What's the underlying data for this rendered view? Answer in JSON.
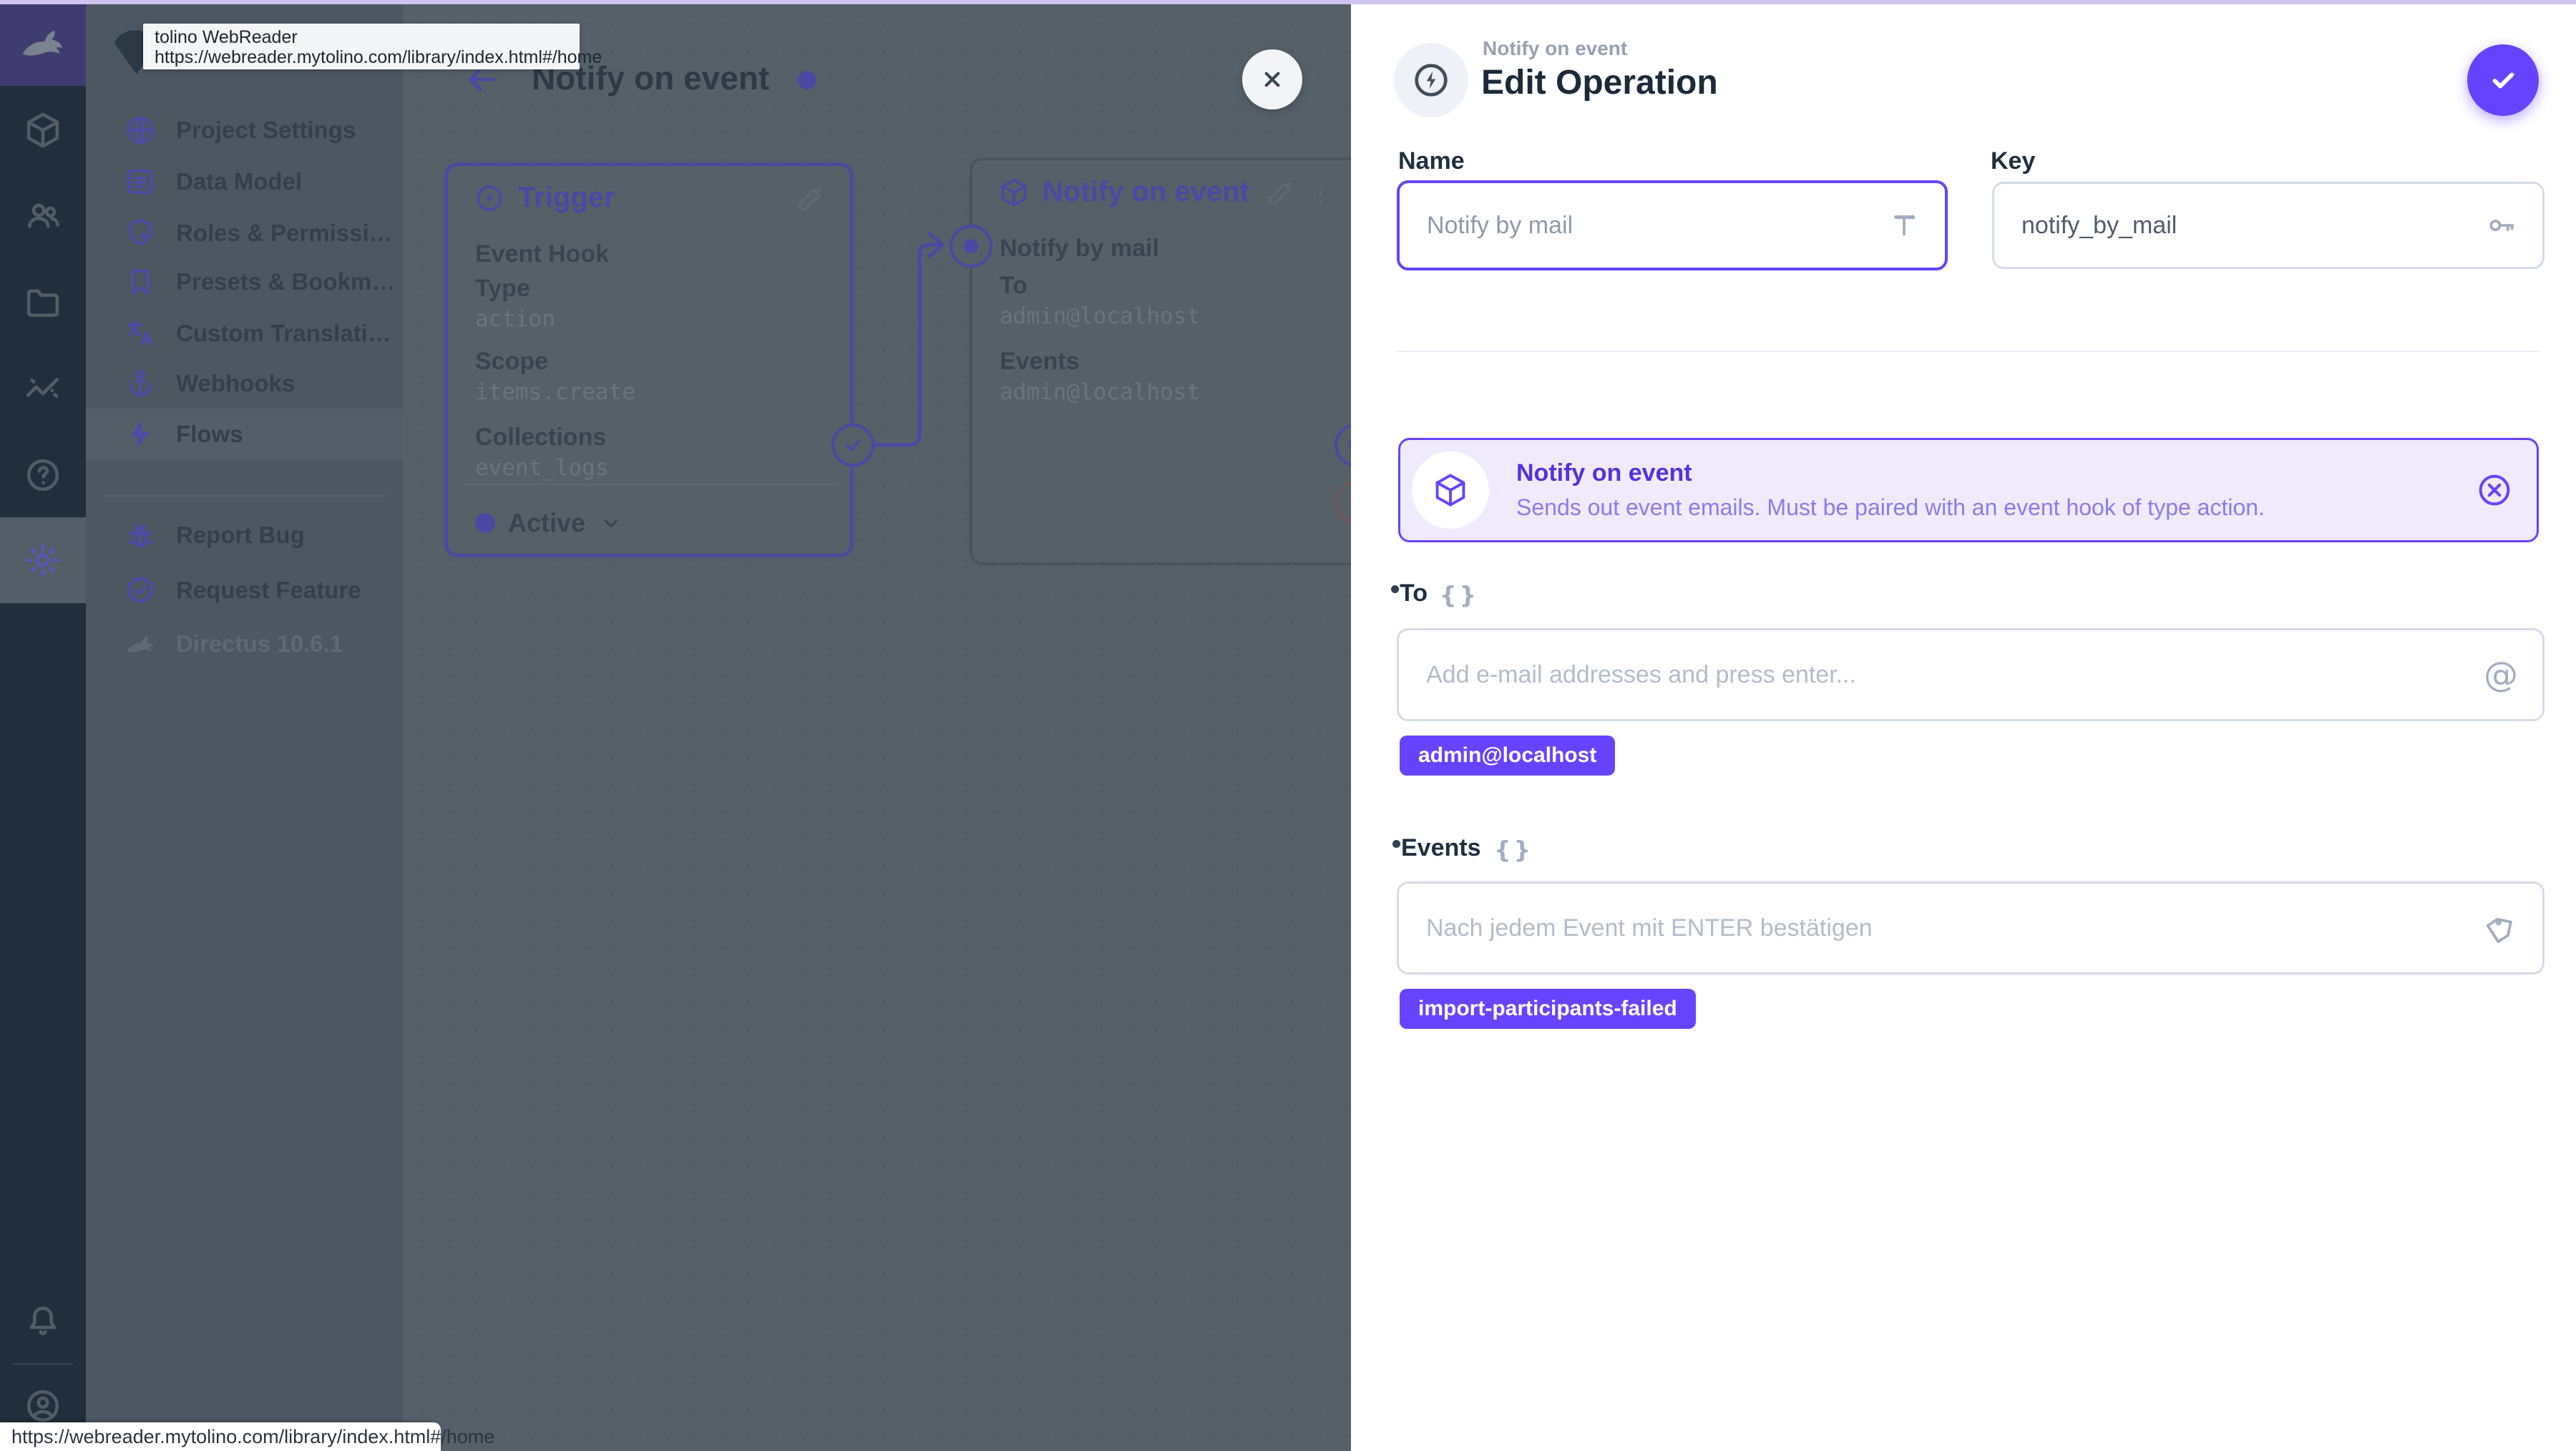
{
  "colors": {
    "accent": "#6644ff",
    "accent-dim": "#4c47a3",
    "top-line": "#cfc3ef",
    "rail-bg": "#222e3b",
    "rail-icon": "#515c66",
    "logo-bg": "#403c72",
    "logo-fg": "#79828e",
    "nav-bg": "#4d5761",
    "nav-active-bg": "#545e68",
    "nav-text": "#343f4b",
    "nav-icon": "#4f4aa5",
    "nav-muted": "#5f6973",
    "canvas-bg": "#566069",
    "canvas-dot": "#515b64",
    "panel-border": "#4a545e",
    "panel-text": "#3a444f",
    "panel-mono": "#6a747e",
    "header-title": "#2e3944",
    "close-bg": "#f2f4f6",
    "drawer-bg": "#ffffff",
    "drawer-title": "#1c2a3a",
    "drawer-breadcrumb": "#98a1b3",
    "badge-bg": "#eef1f8",
    "badge-fg": "#434e5b",
    "field-border": "#d6dce6",
    "placeholder": "#b3bcc8",
    "value-muted": "#8f99a8",
    "value-dark": "#525c6a",
    "icon-muted": "#a5aec0",
    "divider": "#e8ecf2",
    "notice-bg": "#efebfc",
    "notice-title": "#5232dd",
    "notice-sub": "#8d7bea",
    "label-dark": "#213040",
    "reject-node": "#6e585c",
    "statusbar-text": "#2b343e"
  },
  "browser": {
    "tooltip_title": "tolino WebReader",
    "tooltip_url": "https://webreader.mytolino.com/library/index.html#/home",
    "status_url": "https://webreader.mytolino.com/library/index.html#/home"
  },
  "sidebar": {
    "items": [
      {
        "label": "Project Settings"
      },
      {
        "label": "Data Model"
      },
      {
        "label": "Roles & Permissions"
      },
      {
        "label": "Presets & Bookmar..."
      },
      {
        "label": "Custom Translations"
      },
      {
        "label": "Webhooks"
      },
      {
        "label": "Flows"
      }
    ],
    "footer_items": [
      {
        "label": "Report Bug"
      },
      {
        "label": "Request Feature"
      }
    ],
    "version": "Directus 10.6.1"
  },
  "canvas": {
    "title": "Notify on event",
    "trigger_panel": {
      "title": "Trigger",
      "subtitle": "Event Hook",
      "fields": [
        {
          "label": "Type",
          "value": "action"
        },
        {
          "label": "Scope",
          "value": "items.create"
        },
        {
          "label": "Collections",
          "value": "event_logs"
        }
      ],
      "status": "Active"
    },
    "operation_panel": {
      "title": "Notify on event",
      "subtitle": "Notify by mail",
      "fields": [
        {
          "label": "To",
          "value": "admin@localhost"
        },
        {
          "label": "Events",
          "value": "admin@localhost"
        }
      ]
    }
  },
  "drawer": {
    "breadcrumb": "Notify on event",
    "title": "Edit Operation",
    "name_label": "Name",
    "name_value": "Notify by mail",
    "key_label": "Key",
    "key_value": "notify_by_mail",
    "notice_title": "Notify on event",
    "notice_description": "Sends out event emails. Must be paired with an event hook of type action.",
    "to_label": "To",
    "to_placeholder": "Add e-mail addresses and press enter...",
    "to_tags": [
      "admin@localhost"
    ],
    "events_label": "Events",
    "events_placeholder": "Nach jedem Event mit ENTER bestätigen",
    "events_tags": [
      "import-participants-failed"
    ]
  }
}
